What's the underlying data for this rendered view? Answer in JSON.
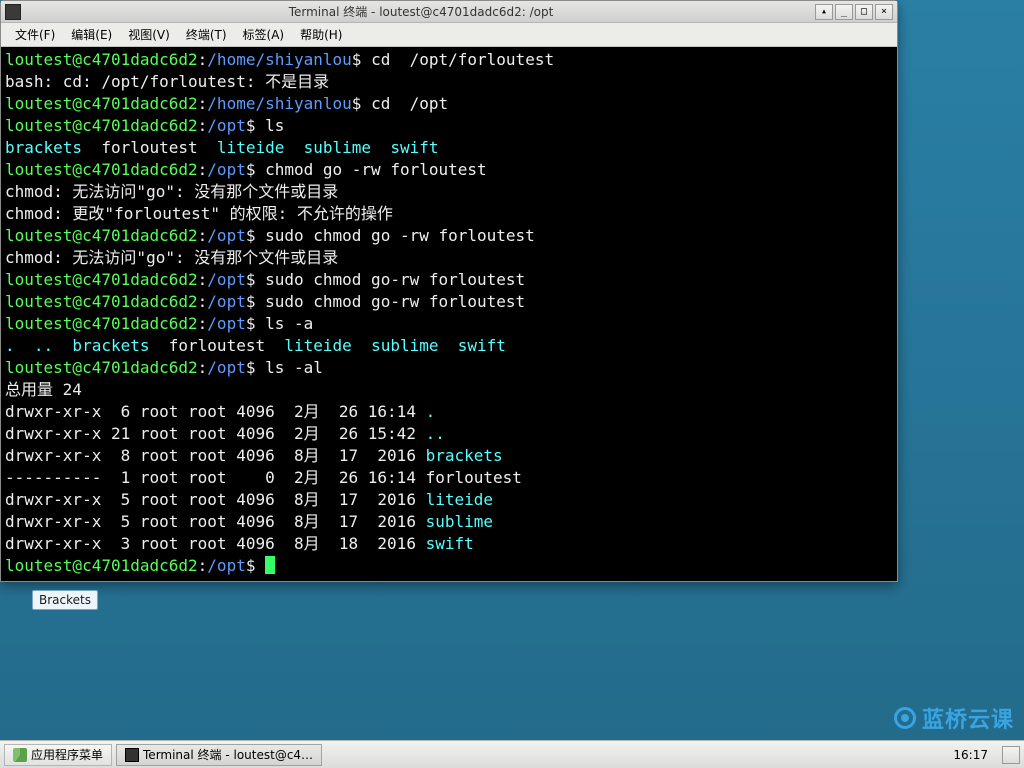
{
  "window": {
    "title": "Terminal 终端 - loutest@c4701dadc6d2: /opt",
    "buttons": {
      "rollup": "▴",
      "min": "_",
      "max": "□",
      "close": "×"
    }
  },
  "menu": {
    "file": "文件(F)",
    "edit": "编辑(E)",
    "view": "视图(V)",
    "terminal": "终端(T)",
    "tabs": "标签(A)",
    "help": "帮助(H)"
  },
  "prompt": {
    "userhost": "loutest@c4701dadc6d2",
    "path_home": "/home/shiyanlou",
    "path_opt": "/opt",
    "sep": ":",
    "end": "$ "
  },
  "lines": {
    "cmd_cd1": "cd  /opt/forloutest",
    "err_cd1": "bash: cd: /opt/forloutest: 不是目录",
    "cmd_cd2": "cd  /opt",
    "cmd_ls": "ls",
    "ls_items": [
      "brackets",
      "forloutest",
      "liteide",
      "sublime",
      "swift"
    ],
    "ls_plain": "  forloutest  ",
    "cmd_chmod1": "chmod go -rw forloutest",
    "err_chmod_go": "chmod: 无法访问\"go\": 没有那个文件或目录",
    "err_chmod_perm": "chmod: 更改\"forloutest\" 的权限: 不允许的操作",
    "cmd_sudo_chmod1": "sudo chmod go -rw forloutest",
    "cmd_sudo_chmod2": "sudo chmod go-rw forloutest",
    "cmd_sudo_chmod3": "sudo chmod go-rw forloutest",
    "cmd_lsa": "ls -a",
    "lsa_dots": ".  ..  ",
    "cmd_lsal": "ls -al",
    "total": "总用量 24",
    "ll": [
      {
        "perm": "drwxr-xr-x",
        "n": " 6",
        "o": "root root",
        "s": "4096",
        "d": " 2月  26 16:14",
        "name": ".",
        "color": "cy"
      },
      {
        "perm": "drwxr-xr-x",
        "n": "21",
        "o": "root root",
        "s": "4096",
        "d": " 2月  26 15:42",
        "name": "..",
        "color": "cy"
      },
      {
        "perm": "drwxr-xr-x",
        "n": " 8",
        "o": "root root",
        "s": "4096",
        "d": " 8月  17  2016",
        "name": "brackets",
        "color": "cy"
      },
      {
        "perm": "----------",
        "n": " 1",
        "o": "root root",
        "s": "   0",
        "d": " 2月  26 16:14",
        "name": "forloutest",
        "color": ""
      },
      {
        "perm": "drwxr-xr-x",
        "n": " 5",
        "o": "root root",
        "s": "4096",
        "d": " 8月  17  2016",
        "name": "liteide",
        "color": "cy"
      },
      {
        "perm": "drwxr-xr-x",
        "n": " 5",
        "o": "root root",
        "s": "4096",
        "d": " 8月  17  2016",
        "name": "sublime",
        "color": "cy"
      },
      {
        "perm": "drwxr-xr-x",
        "n": " 3",
        "o": "root root",
        "s": "4096",
        "d": " 8月  18  2016",
        "name": "swift",
        "color": "cy"
      }
    ]
  },
  "desktop": {
    "brackets": "Brackets"
  },
  "taskbar": {
    "start": "应用程序菜单",
    "task1": "Terminal 终端 - loutest@c4…",
    "clock": "16:17"
  },
  "watermark": "蓝桥云课"
}
